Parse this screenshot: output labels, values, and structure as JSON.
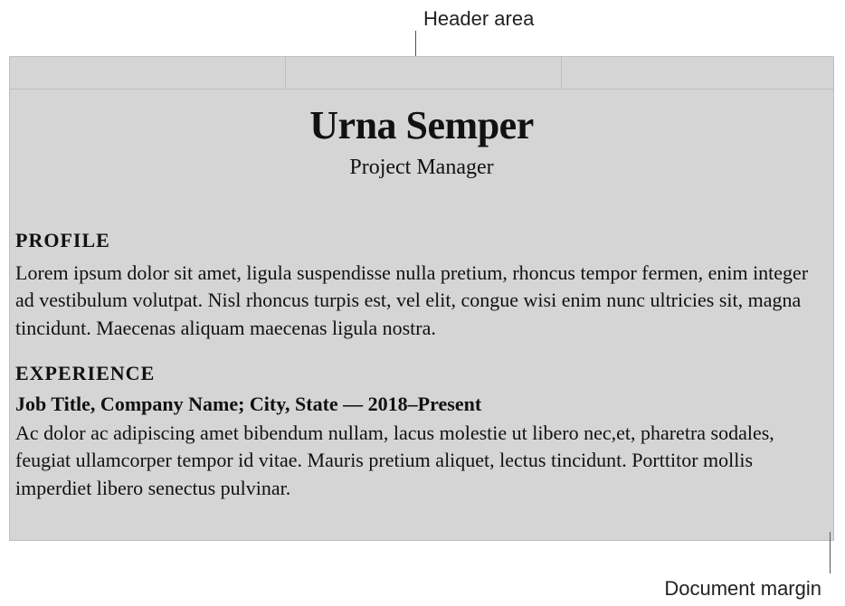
{
  "annotations": {
    "header": "Header area",
    "margin": "Document margin"
  },
  "resume": {
    "name": "Urna Semper",
    "title": "Project Manager",
    "sections": {
      "profile": {
        "heading": "PROFILE",
        "body": "Lorem ipsum dolor sit amet, ligula suspendisse nulla pretium, rhoncus tempor fermen, enim integer ad vestibulum volutpat. Nisl rhoncus turpis est, vel elit, congue wisi enim nunc ultricies sit, magna tincidunt. Maecenas aliquam maecenas ligula nostra."
      },
      "experience": {
        "heading": "EXPERIENCE",
        "job_line": "Job Title, Company Name; City, State — 2018–Present",
        "body": "Ac dolor ac adipiscing amet bibendum nullam, lacus molestie ut libero nec,et, pharetra sodales, feugiat ullamcorper tempor id vitae. Mauris pretium aliquet, lectus tincidunt. Porttitor mollis imperdiet libero senectus pulvinar."
      }
    }
  }
}
